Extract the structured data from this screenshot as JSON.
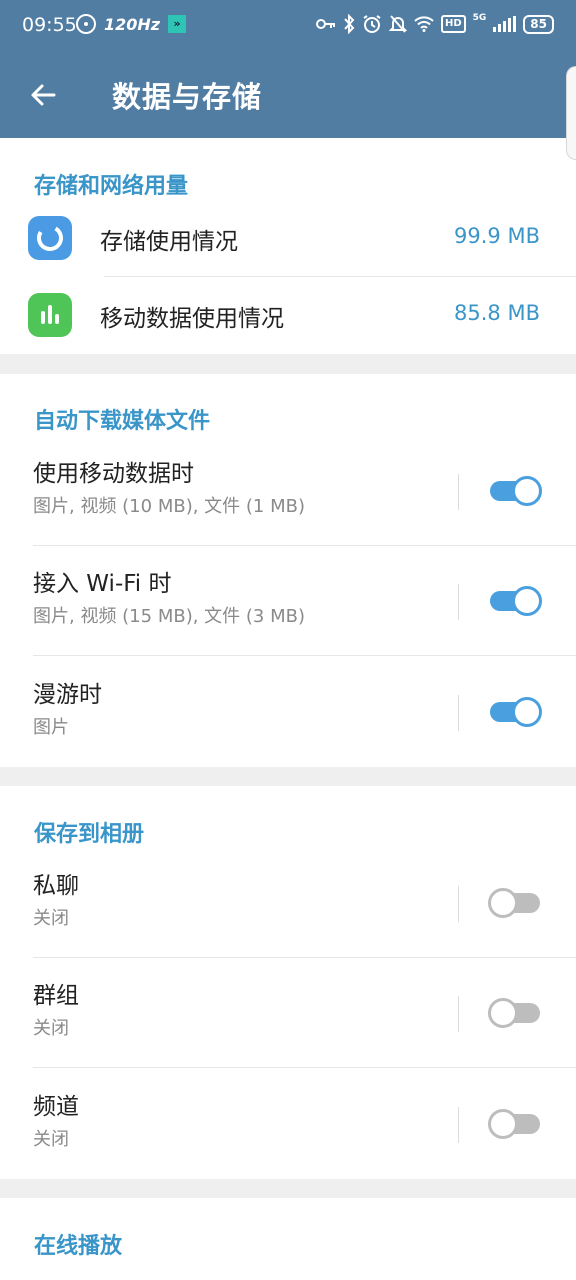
{
  "status_bar": {
    "time": "09:55",
    "refresh_rate": "120Hz",
    "battery": "85",
    "network": "5G",
    "hd_badge": "HD",
    "left_icons": [
      "fan-icon",
      "refresh-rate-icon",
      "app-notification-icon"
    ],
    "right_icons": [
      "key-icon",
      "bluetooth-icon",
      "alarm-icon",
      "mute-bell-icon",
      "wifi-icon",
      "hd-icon",
      "signal-icon",
      "battery-icon"
    ]
  },
  "header": {
    "title": "数据与存储",
    "back_icon": "arrow-left-icon"
  },
  "storage_section": {
    "title": "存储和网络用量",
    "items": [
      {
        "label": "存储使用情况",
        "value": "99.9 MB",
        "icon": "storage-pie-icon",
        "color": "#4a9ae4"
      },
      {
        "label": "移动数据使用情况",
        "value": "85.8 MB",
        "icon": "bar-chart-icon",
        "color": "#4fc557"
      }
    ]
  },
  "auto_download_section": {
    "title": "自动下载媒体文件",
    "items": [
      {
        "title": "使用移动数据时",
        "subtitle": "图片, 视频 (10 MB), 文件 (1 MB)",
        "enabled": true
      },
      {
        "title": "接入 Wi-Fi 时",
        "subtitle": "图片, 视频 (15 MB), 文件 (3 MB)",
        "enabled": true
      },
      {
        "title": "漫游时",
        "subtitle": "图片",
        "enabled": true
      }
    ]
  },
  "save_to_gallery_section": {
    "title": "保存到相册",
    "items": [
      {
        "title": "私聊",
        "subtitle": "关闭",
        "enabled": false
      },
      {
        "title": "群组",
        "subtitle": "关闭",
        "enabled": false
      },
      {
        "title": "频道",
        "subtitle": "关闭",
        "enabled": false
      }
    ]
  },
  "streaming_section": {
    "title": "在线播放"
  },
  "colors": {
    "header_bg": "#527da3",
    "accent": "#3a95c9",
    "switch_on": "#4a9fdf",
    "switch_off": "#bdbdbd"
  }
}
